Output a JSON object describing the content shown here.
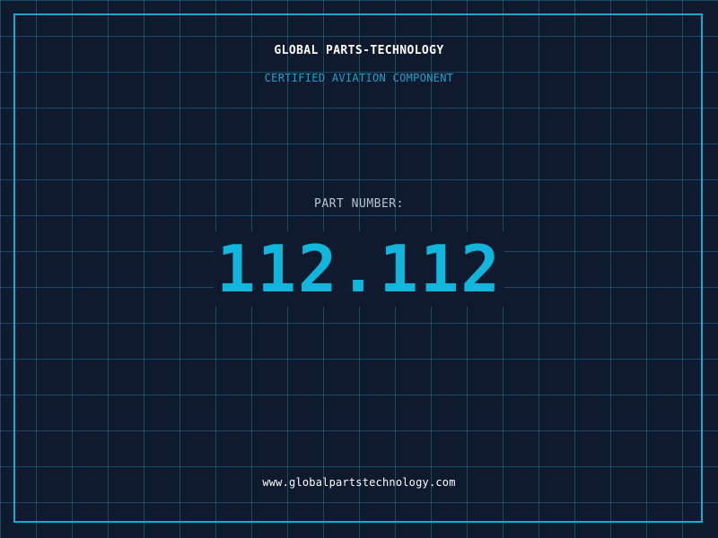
{
  "header": {
    "company": "GLOBAL PARTS-TECHNOLOGY",
    "subtitle": "CERTIFIED AVIATION COMPONENT"
  },
  "part": {
    "label": "PART NUMBER:",
    "number": "112.112"
  },
  "footer": {
    "website": "www.globalpartstechnology.com"
  },
  "colors": {
    "background": "#0f1a2e",
    "grid": "#286e8c",
    "accent": "#17a9cf",
    "part_number": "#12b6dc",
    "label": "#b8c4d4",
    "text": "#ffffff"
  }
}
